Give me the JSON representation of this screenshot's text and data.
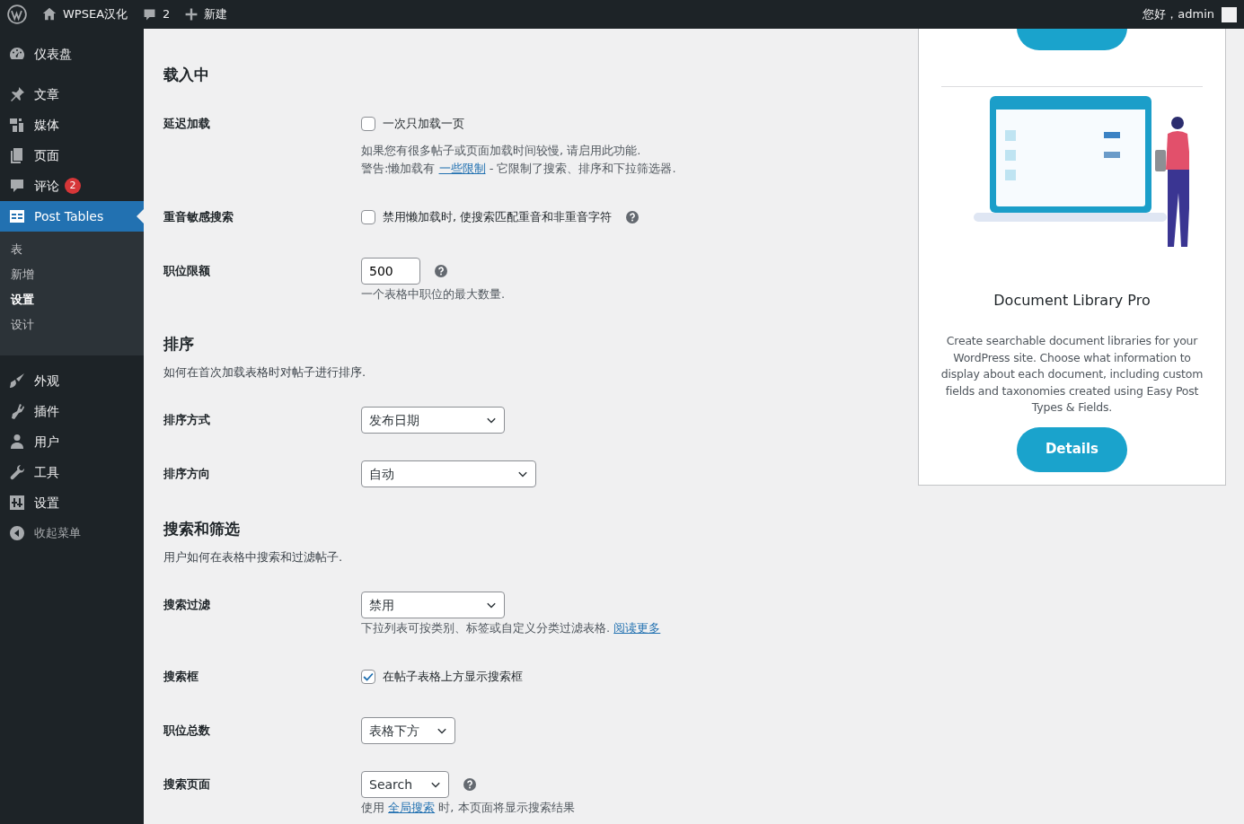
{
  "admin_bar": {
    "site_name": "WPSEA汉化",
    "comments_count": "2",
    "new_label": "新建",
    "greeting": "您好，admin"
  },
  "sidebar": {
    "items": [
      {
        "label": "仪表盘",
        "selected": false
      },
      {
        "label": "文章",
        "selected": false
      },
      {
        "label": "媒体",
        "selected": false
      },
      {
        "label": "页面",
        "selected": false
      },
      {
        "label": "评论",
        "selected": false,
        "badge": "2"
      },
      {
        "label": "Post Tables",
        "selected": true,
        "children": [
          {
            "label": "表",
            "selected": false
          },
          {
            "label": "新增",
            "selected": false
          },
          {
            "label": "设置",
            "selected": true
          },
          {
            "label": "设计",
            "selected": false
          }
        ]
      },
      {
        "label": "外观",
        "selected": false
      },
      {
        "label": "插件",
        "selected": false
      },
      {
        "label": "用户",
        "selected": false
      },
      {
        "label": "工具",
        "selected": false
      },
      {
        "label": "设置",
        "selected": false
      },
      {
        "label": "收起菜单",
        "selected": false,
        "kind": "collapse"
      }
    ]
  },
  "sections": [
    {
      "title": "载入中",
      "rows": [
        {
          "label": "延迟加载",
          "kind": "checkbox",
          "checked": false,
          "text": "一次只加载一页",
          "notes": [
            [
              {
                "text": "如果您有很多帖子或页面加载时间较慢, 请启用此功能."
              }
            ],
            [
              {
                "text": "警告:懒加载有 "
              },
              {
                "link": "一些限制"
              },
              {
                "text": " - 它限制了搜索、排序和下拉筛选器."
              }
            ]
          ]
        },
        {
          "label": "重音敏感搜索",
          "kind": "checkbox",
          "checked": false,
          "text": "禁用懒加载时, 使搜索匹配重音和非重音字符",
          "help": true
        },
        {
          "label": "职位限额",
          "kind": "number",
          "value": "500",
          "help": true,
          "notes": [
            [
              {
                "text": "一个表格中职位的最大数量."
              }
            ]
          ]
        }
      ]
    },
    {
      "title": "排序",
      "description": "如何在首次加载表格时对帖子进行排序.",
      "rows": [
        {
          "label": "排序方式",
          "kind": "select",
          "value": "发布日期"
        },
        {
          "label": "排序方向",
          "kind": "select",
          "value": "自动"
        }
      ]
    },
    {
      "title": "搜索和筛选",
      "description": "用户如何在表格中搜索和过滤帖子.",
      "rows": [
        {
          "label": "搜索过滤",
          "kind": "select",
          "value": "禁用",
          "notes": [
            [
              {
                "text": "下拉列表可按类别、标签或自定义分类过滤表格. "
              },
              {
                "link": "阅读更多"
              }
            ]
          ]
        },
        {
          "label": "搜索框",
          "kind": "checkbox",
          "checked": true,
          "text": "在帖子表格上方显示搜索框"
        },
        {
          "label": "职位总数",
          "kind": "select",
          "value": "表格下方"
        },
        {
          "label": "搜索页面",
          "kind": "select",
          "value": "Search",
          "help": true,
          "notes": [
            [
              {
                "text": "使用 "
              },
              {
                "link": "全局搜索"
              },
              {
                "text": " 时, 本页面将显示搜索结果"
              }
            ]
          ]
        }
      ]
    }
  ],
  "promo": {
    "title": "Document Library Pro",
    "text": "Create searchable document libraries for your WordPress site. Choose what information to display about each document, including custom fields and taxonomies created using Easy Post Types & Fields.",
    "button": "Details"
  }
}
